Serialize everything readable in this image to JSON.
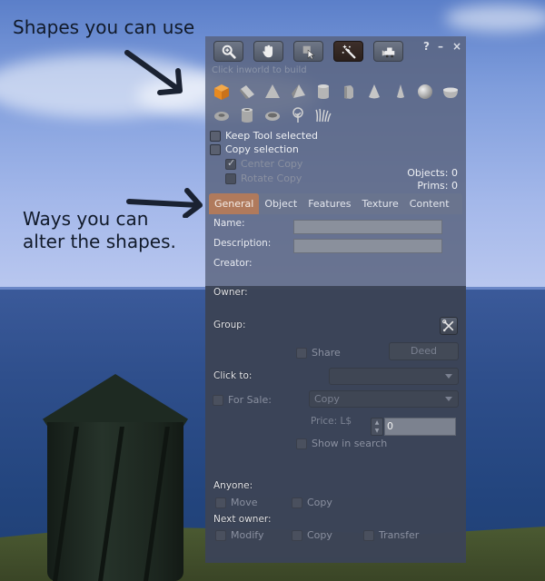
{
  "annotations": {
    "shapes": "Shapes you can use",
    "ways_line1": "Ways you can",
    "ways_line2": "alter the shapes."
  },
  "toolbar": {
    "tools": [
      {
        "name": "focus",
        "icon": "magnifier-icon",
        "active": false
      },
      {
        "name": "move",
        "icon": "hand-icon",
        "active": false
      },
      {
        "name": "edit",
        "icon": "select-arrow-icon",
        "active": false
      },
      {
        "name": "create",
        "icon": "magic-wand-icon",
        "active": true
      },
      {
        "name": "land",
        "icon": "bulldozer-icon",
        "active": false
      }
    ],
    "help_label": "?",
    "minimize_label": "–",
    "close_label": "×",
    "hint": "Click inworld to build"
  },
  "shapes": {
    "row1": [
      "cube",
      "prism",
      "pyramid",
      "tetrahedron",
      "cylinder",
      "half-cylinder",
      "cone",
      "half-cone",
      "sphere",
      "hemisphere"
    ],
    "row2": [
      "torus",
      "tube",
      "ring",
      "tree",
      "grass"
    ],
    "selected": "cube"
  },
  "options": {
    "keep_tool": {
      "label": "Keep Tool selected",
      "checked": false
    },
    "copy_selection": {
      "label": "Copy selection",
      "checked": false
    },
    "center_copy": {
      "label": "Center Copy",
      "checked": true,
      "enabled": false
    },
    "rotate_copy": {
      "label": "Rotate Copy",
      "checked": false,
      "enabled": false
    }
  },
  "counts": {
    "objects": "Objects: 0",
    "prims": "Prims: 0"
  },
  "tabs": [
    {
      "label": "General",
      "active": true
    },
    {
      "label": "Object",
      "active": false
    },
    {
      "label": "Features",
      "active": false
    },
    {
      "label": "Texture",
      "active": false
    },
    {
      "label": "Content",
      "active": false
    }
  ],
  "general": {
    "name_label": "Name:",
    "name_value": "",
    "description_label": "Description:",
    "description_value": "",
    "creator_label": "Creator:",
    "owner_label": "Owner:",
    "group_label": "Group:",
    "share_label": "Share",
    "deed_label": "Deed",
    "click_to_label": "Click to:",
    "click_to_value": "",
    "for_sale_label": "For Sale:",
    "sale_type_value": "Copy",
    "price_label": "Price: L$",
    "price_value": "0",
    "show_in_search_label": "Show in search",
    "anyone_label": "Anyone:",
    "anyone_move": "Move",
    "anyone_copy": "Copy",
    "next_owner_label": "Next owner:",
    "next_modify": "Modify",
    "next_copy": "Copy",
    "next_transfer": "Transfer"
  }
}
